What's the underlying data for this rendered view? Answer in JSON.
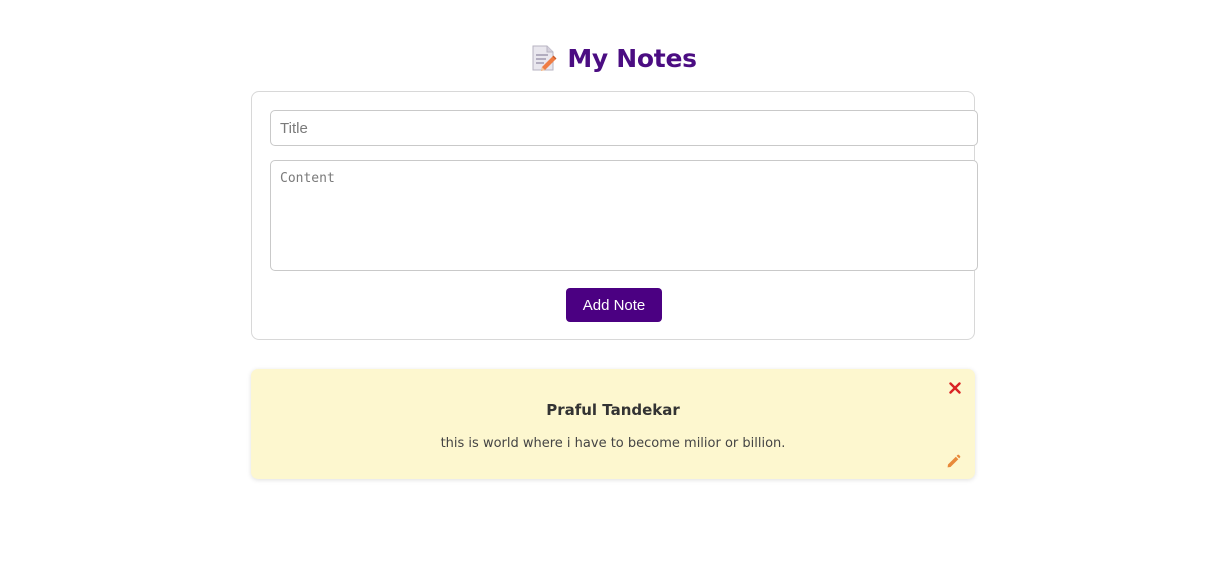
{
  "header": {
    "icon": "memo-icon",
    "title": "My Notes",
    "title_color": "#4b0d82"
  },
  "form": {
    "title_placeholder": "Title",
    "title_value": "",
    "content_placeholder": "Content",
    "content_value": "",
    "add_button_label": "Add Note",
    "add_button_color": "#4b0082"
  },
  "notes": [
    {
      "title": "Praful Tandekar",
      "content": "this is world where i have to become milior or billion.",
      "background": "#fdf7cf",
      "delete_icon": "close-icon",
      "delete_icon_color": "#d92323",
      "edit_icon": "pencil-icon",
      "edit_icon_color": "#e8893a"
    }
  ]
}
